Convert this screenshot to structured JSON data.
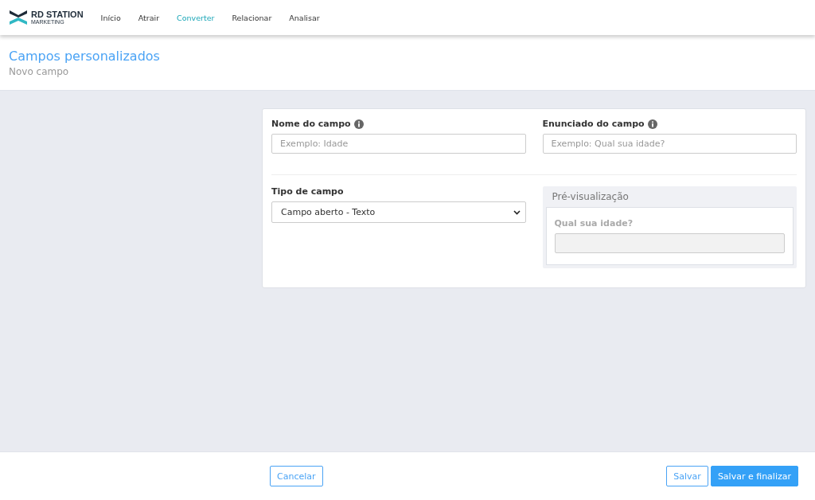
{
  "brand": {
    "name": "RD STATION",
    "sub": "MARKETING"
  },
  "nav": [
    {
      "label": "Início",
      "selected": false
    },
    {
      "label": "Atrair",
      "selected": false
    },
    {
      "label": "Converter",
      "selected": true
    },
    {
      "label": "Relacionar",
      "selected": false
    },
    {
      "label": "Analisar",
      "selected": false
    }
  ],
  "header": {
    "title": "Campos personalizados",
    "subtitle": "Novo campo"
  },
  "form": {
    "name_field": {
      "label": "Nome do campo",
      "placeholder": "Exemplo: Idade"
    },
    "statement_field": {
      "label": "Enunciado do campo",
      "placeholder": "Exemplo: Qual sua idade?"
    },
    "type_field": {
      "label": "Tipo de campo",
      "value": "Campo aberto - Texto"
    },
    "preview": {
      "title": "Pré-visualização",
      "question": "Qual sua idade?"
    }
  },
  "footer": {
    "cancel": "Cancelar",
    "save": "Salvar",
    "save_finish": "Salvar e finalizar"
  }
}
